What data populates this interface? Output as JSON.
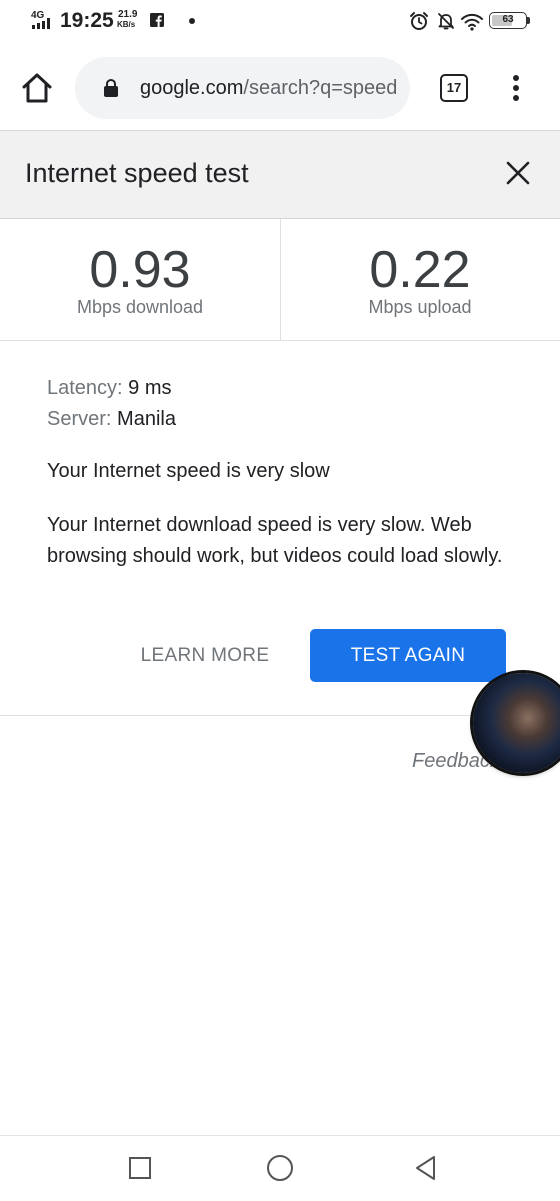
{
  "status_bar": {
    "network_type": "4G",
    "time": "19:25",
    "data_speed_value": "21.9",
    "data_speed_unit": "KB/s",
    "battery_level": "63",
    "icons": [
      "signal-icon",
      "facebook-icon",
      "notification-dot-icon",
      "alarm-icon",
      "bell-off-icon",
      "wifi-icon",
      "battery-icon"
    ]
  },
  "browser": {
    "url_domain": "google.com",
    "url_path": "/search?q=speed",
    "tab_count": "17",
    "icons": [
      "home-icon",
      "lock-icon",
      "tabs-icon",
      "overflow-menu-icon"
    ]
  },
  "speed_test": {
    "title": "Internet speed test",
    "download": {
      "value": "0.93",
      "label": "Mbps download"
    },
    "upload": {
      "value": "0.22",
      "label": "Mbps upload"
    },
    "latency_label": "Latency:",
    "latency_value": "9 ms",
    "server_label": "Server:",
    "server_value": "Manila",
    "summary": "Your Internet speed is very slow",
    "description": "Your Internet download speed is very slow. Web browsing should work, but videos could load slowly.",
    "learn_more_label": "LEARN MORE",
    "test_again_label": "TEST AGAIN",
    "feedback_label": "Feedback"
  },
  "colors": {
    "accent": "#1a73e8",
    "header_bg": "#f1f1f1",
    "secondary_text": "#70757a"
  }
}
